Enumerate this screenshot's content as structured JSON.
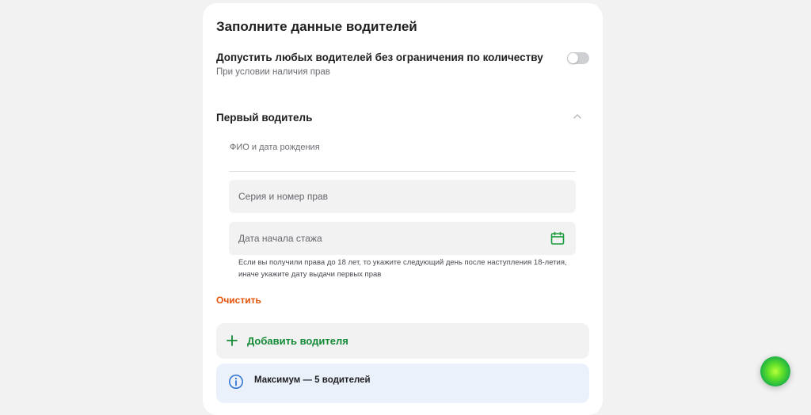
{
  "title": "Заполните данные водителей",
  "unlimited_drivers": {
    "label": "Допустить любых водителей без ограничения по количеству",
    "sublabel": "При условии наличия прав",
    "enabled": false
  },
  "driver_section": {
    "title": "Первый водитель",
    "expanded": true,
    "fields": {
      "fio_birth_placeholder": "ФИО и дата рождения",
      "license_placeholder": "Серия и номер прав",
      "experience_start_placeholder": "Дата начала стажа"
    },
    "hint_line1": "Если вы получили права до 18 лет, то укажите следующий день после наступления 18-летия,",
    "hint_line2": "иначе укажите дату выдачи первых прав",
    "clear_label": "Очистить"
  },
  "add_driver": {
    "label": "Добавить водителя",
    "icon": "plus-icon"
  },
  "info": {
    "text": "Максимум — 5 водителей",
    "icon": "info-icon"
  },
  "colors": {
    "accent_green": "#138a36",
    "clear_orange": "#e35205",
    "info_blue": "#2b6fd6",
    "card_bg": "#ffffff",
    "page_bg": "#f2f2f2"
  }
}
